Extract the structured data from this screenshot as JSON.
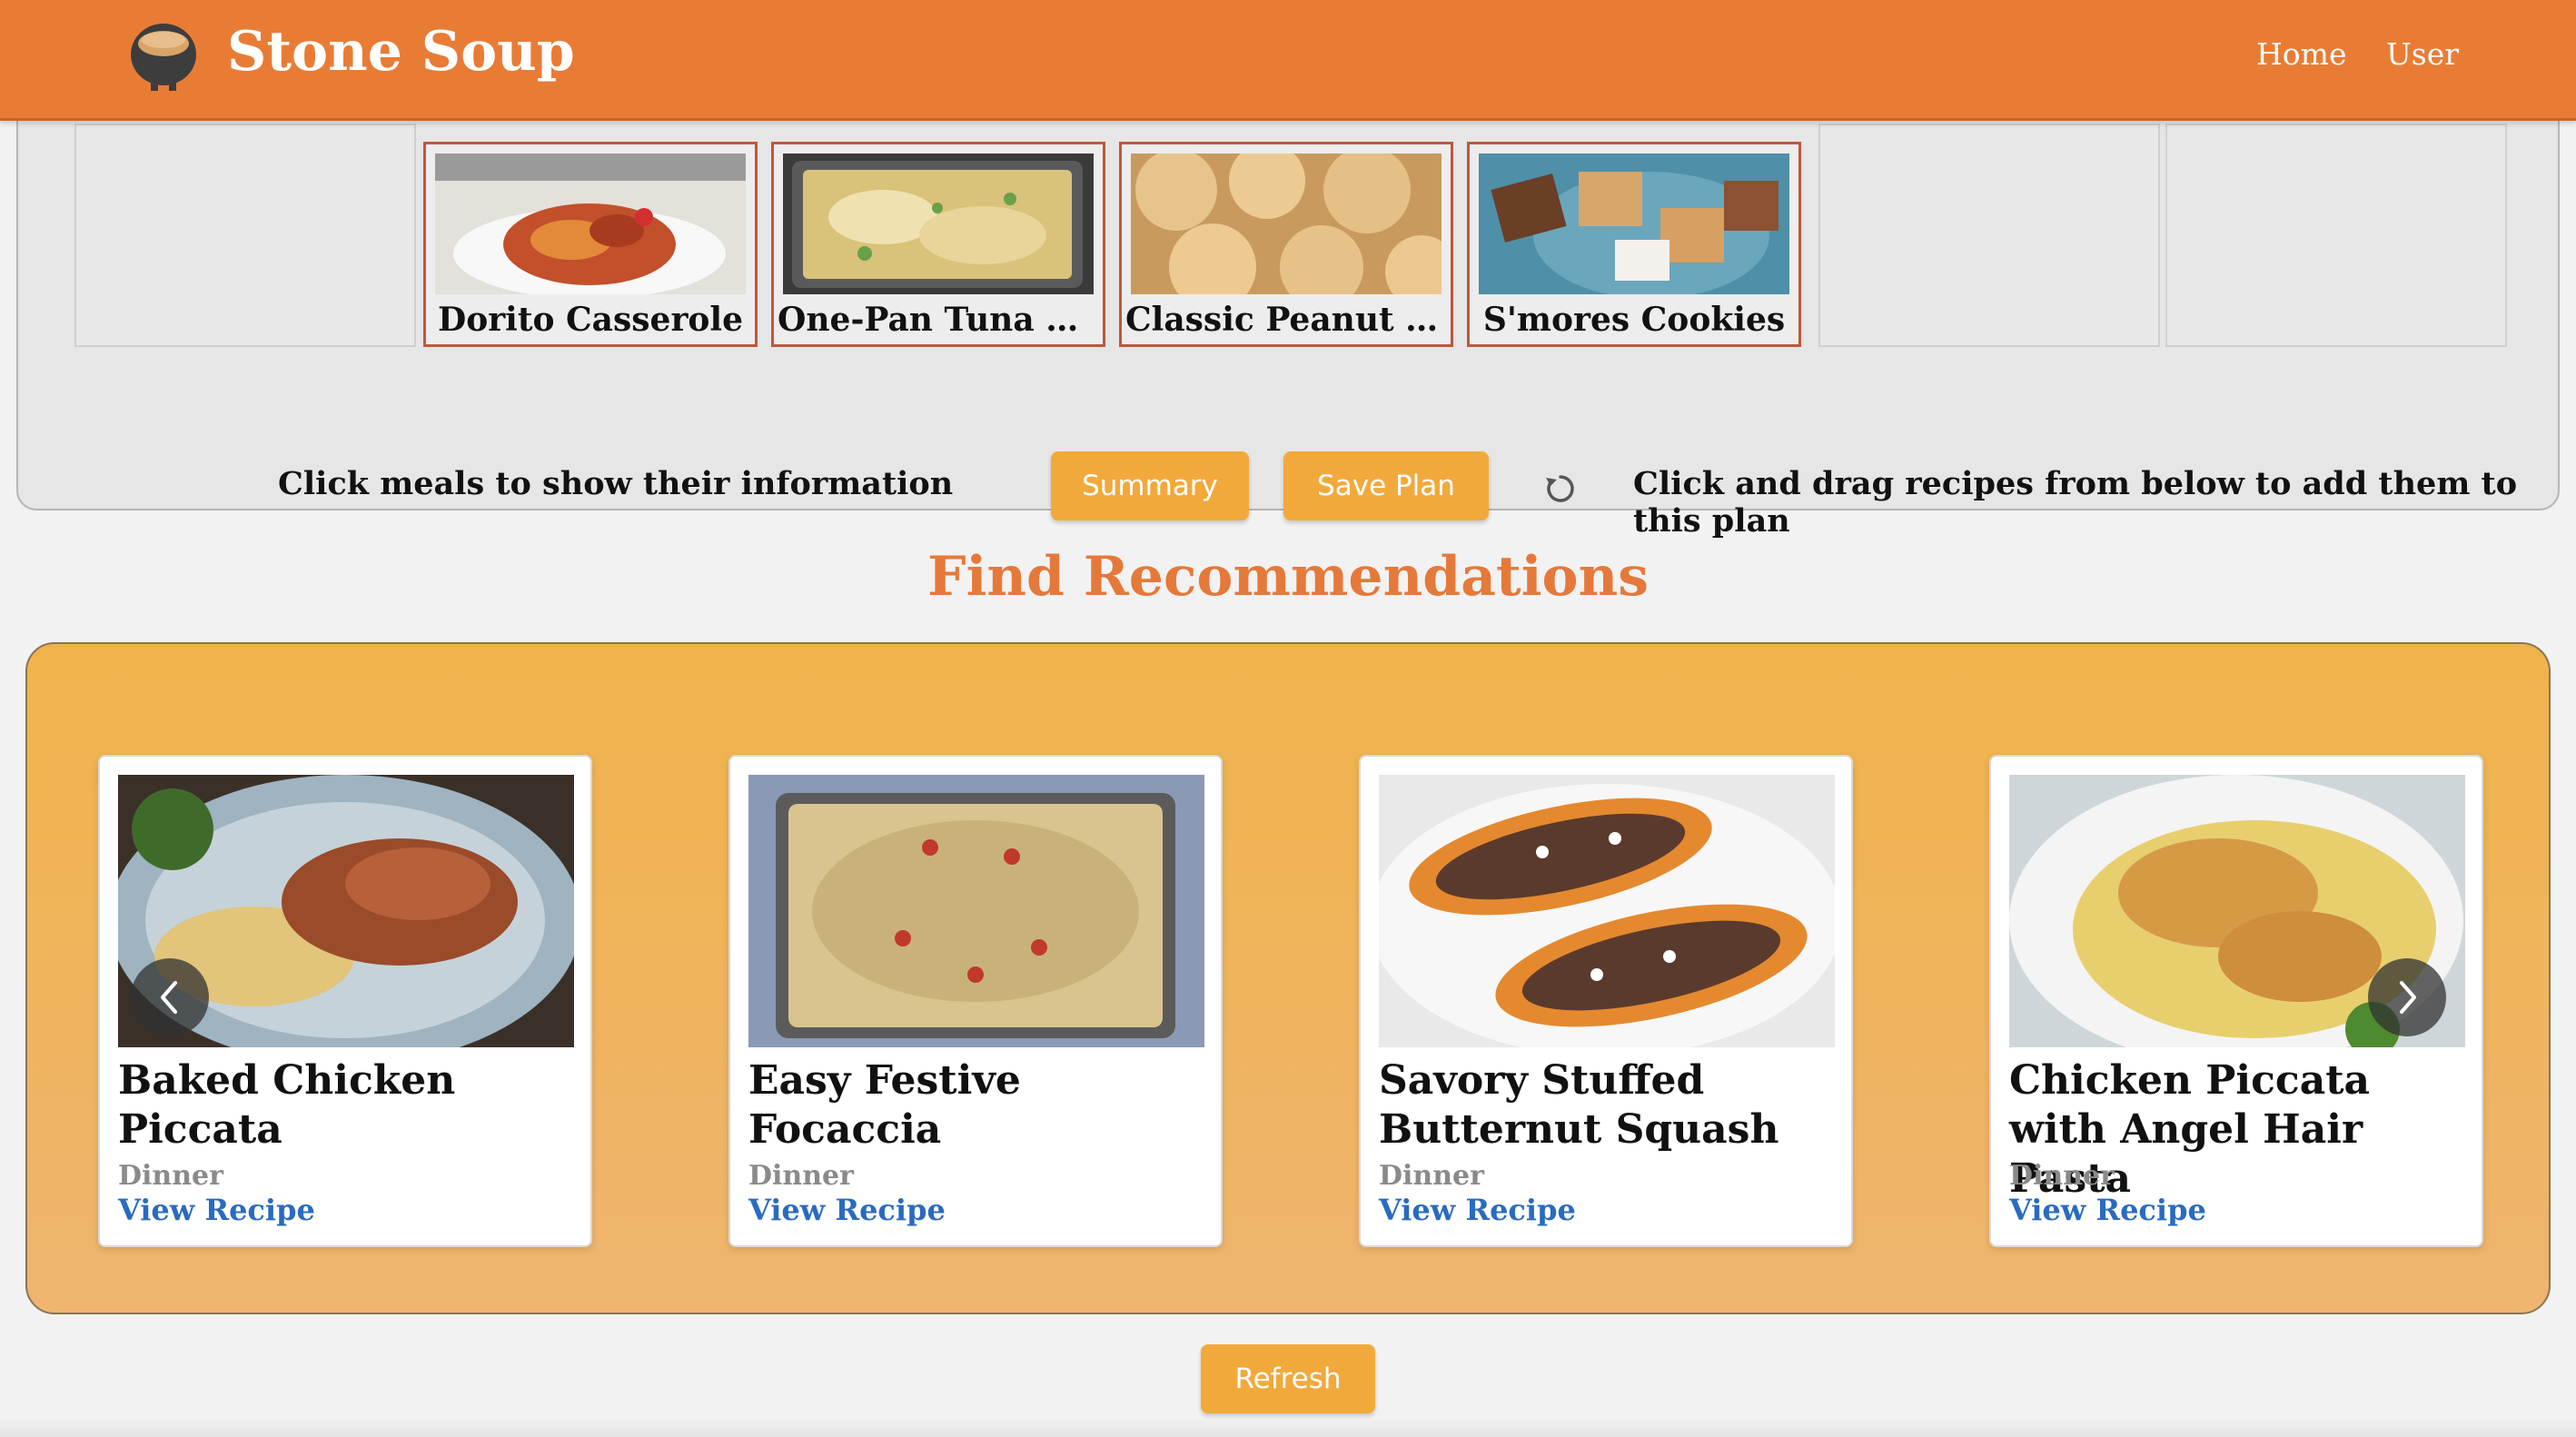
{
  "header": {
    "brand": "Stone Soup",
    "nav": {
      "home": "Home",
      "user": "User"
    },
    "colors": {
      "bar": "#e97c35"
    }
  },
  "plan": {
    "meals": [
      {
        "name": "Dorito Casserole",
        "icon": "casserole-photo"
      },
      {
        "name": "One-Pan Tuna Noodle Casserole",
        "icon": "tuna-noodle-photo"
      },
      {
        "name": "Classic Peanut Butter Cookies",
        "icon": "peanut-cookies-photo"
      },
      {
        "name": "S'mores Cookies",
        "icon": "smores-cookies-photo"
      }
    ],
    "hint_left": "Click meals to show their information",
    "hint_right": "Click and drag recipes from below to add them to this plan",
    "summary_label": "Summary",
    "save_label": "Save Plan",
    "reset_icon": "reset-icon"
  },
  "recommendations": {
    "title": "Find Recommendations",
    "cards": [
      {
        "name": "Baked Chicken Piccata",
        "category": "Dinner",
        "link": "View Recipe"
      },
      {
        "name": "Easy Festive Focaccia",
        "category": "Dinner",
        "link": "View Recipe"
      },
      {
        "name": "Savory Stuffed Butternut Squash",
        "category": "Dinner",
        "link": "View Recipe"
      },
      {
        "name": "Chicken Piccata with Angel Hair Pasta",
        "category": "Dinner",
        "link": "View Recipe"
      }
    ],
    "refresh_label": "Refresh",
    "accent": "#f2a93b",
    "title_color": "#e5793a"
  }
}
